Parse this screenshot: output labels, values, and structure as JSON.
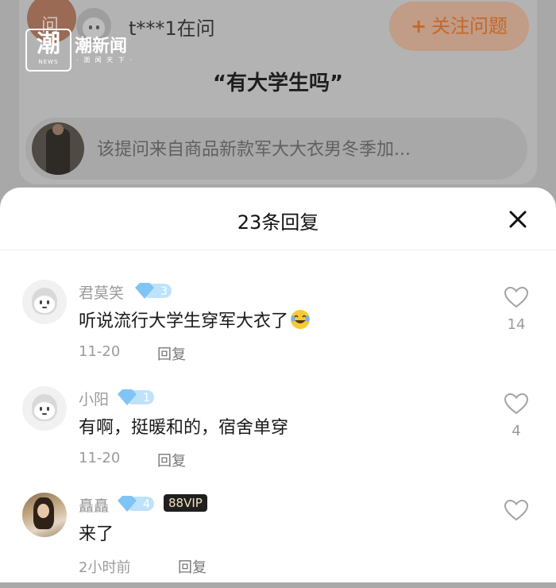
{
  "background": {
    "asker": "t***1在问",
    "follow_button": "关注问题",
    "follow_plus": "+",
    "ask_icon_text": "问",
    "question_title": "“有大学生吗”",
    "product_text": "该提问来自商品新款军大大衣男冬季加...",
    "logo_glyph": "潮",
    "logo_news": "NEWS",
    "logo_name": "潮新闻",
    "logo_sub": "· 潮 闻 天 下 ·"
  },
  "sheet": {
    "title": "23条回复",
    "close_icon": "close-icon"
  },
  "comments": [
    {
      "name": "君莫笑",
      "level": "3",
      "text": "听说流行大学生穿军大衣了",
      "emoji": "laughing-tears-emoji",
      "date": "11-20",
      "reply": "回复",
      "likes": "14"
    },
    {
      "name": "小阳",
      "level": "1",
      "text": "有啊，挺暖和的，宿舍单穿",
      "date": "11-20",
      "reply": "回复",
      "likes": "4"
    },
    {
      "name": "矗矗",
      "level": "4",
      "vip": "88VIP",
      "text": "来了",
      "date": "2小时前",
      "reply": "回复",
      "likes": ""
    }
  ],
  "colors": {
    "overlay_gray": "#a8a8a8",
    "follow_text": "#c4682a",
    "level_badge": "#7fc4f5",
    "vip_bg": "#1f1f1f",
    "vip_text": "#f2e1b8"
  }
}
